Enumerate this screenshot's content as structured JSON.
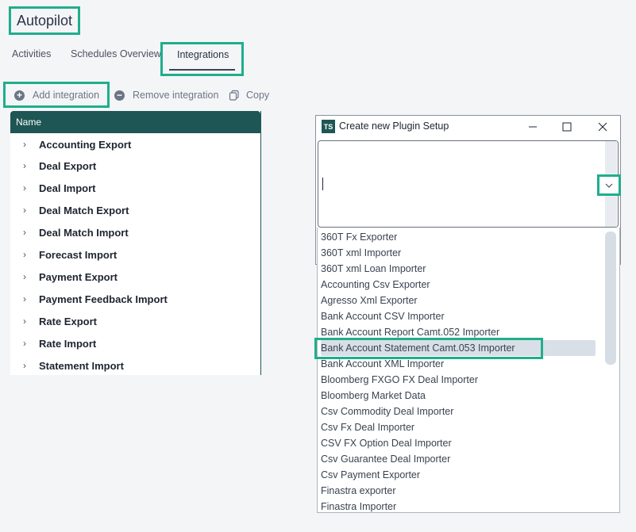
{
  "app": {
    "title": "Autopilot"
  },
  "tabs": [
    {
      "label": "Activities"
    },
    {
      "label": "Schedules Overview"
    },
    {
      "label": "Integrations"
    }
  ],
  "toolbar": {
    "add_label": "Add integration",
    "remove_label": "Remove integration",
    "copy_label": "Copy"
  },
  "tree": {
    "header": "Name",
    "items": [
      "Accounting Export",
      "Deal Export",
      "Deal Import",
      "Deal Match Export",
      "Deal Match Import",
      "Forecast Import",
      "Payment Export",
      "Payment Feedback Import",
      "Rate Export",
      "Rate Import",
      "Statement Import"
    ]
  },
  "dialog": {
    "logo": "TS",
    "title": "Create new Plugin Setup",
    "combo_value": "",
    "options": [
      "360T Fx Exporter",
      "360T xml Importer",
      "360T xml Loan Importer",
      "Accounting Csv Exporter",
      "Agresso Xml Exporter",
      "Bank Account CSV Importer",
      "Bank Account Report Camt.052 Importer",
      "Bank Account Statement Camt.053 Importer",
      "Bank Account XML Importer",
      "Bloomberg FXGO FX Deal Importer",
      "Bloomberg Market Data",
      "Csv Commodity Deal Importer",
      "Csv Fx Deal Importer",
      "CSV FX Option Deal Importer",
      "Csv Guarantee Deal Importer",
      "Csv Payment Exporter",
      "Finastra exporter",
      "Finastra Importer"
    ],
    "selected_index": 7
  },
  "colors": {
    "highlight": "#1fae8c",
    "header_bg": "#1d5654"
  }
}
